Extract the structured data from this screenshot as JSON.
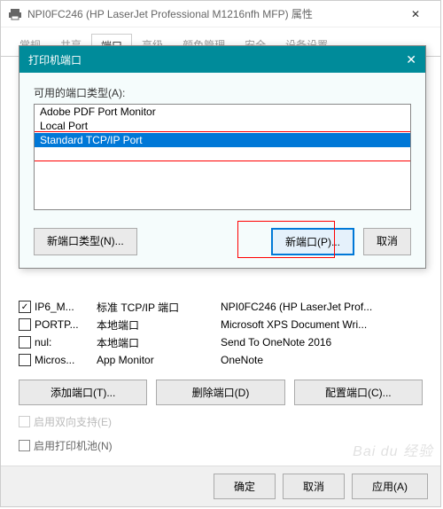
{
  "window": {
    "title": "NPI0FC246 (HP LaserJet Professional M1216nfh MFP) 属性"
  },
  "tabs": {
    "t0": "常规",
    "t1": "共享",
    "t2": "端口",
    "t3": "高级",
    "t4": "颜色管理",
    "t5": "安全",
    "t6": "设备设置"
  },
  "modal": {
    "title": "打印机端口",
    "label": "可用的端口类型(A):",
    "items": {
      "i0": "Adobe PDF Port Monitor",
      "i1": "Local Port",
      "i2": "Standard TCP/IP Port"
    },
    "btn_new_type": "新端口类型(N)...",
    "btn_new_port": "新端口(P)...",
    "btn_cancel": "取消"
  },
  "ports": {
    "r0": {
      "checked": true,
      "name": "IP6_M...",
      "desc": "标准 TCP/IP 端口",
      "printer": "NPI0FC246 (HP LaserJet Prof..."
    },
    "r1": {
      "checked": false,
      "name": "PORTP...",
      "desc": "本地端口",
      "printer": "Microsoft XPS Document Wri..."
    },
    "r2": {
      "checked": false,
      "name": "nul:",
      "desc": "本地端口",
      "printer": "Send To OneNote 2016"
    },
    "r3": {
      "checked": false,
      "name": "Micros...",
      "desc": "App Monitor",
      "printer": "OneNote"
    }
  },
  "port_btns": {
    "add": "添加端口(T)...",
    "del": "删除端口(D)",
    "cfg": "配置端口(C)..."
  },
  "options": {
    "bidir": "启用双向支持(E)",
    "pool": "启用打印机池(N)"
  },
  "footer": {
    "ok": "确定",
    "cancel": "取消",
    "apply": "应用(A)"
  },
  "watermark": "Bai du 经验"
}
